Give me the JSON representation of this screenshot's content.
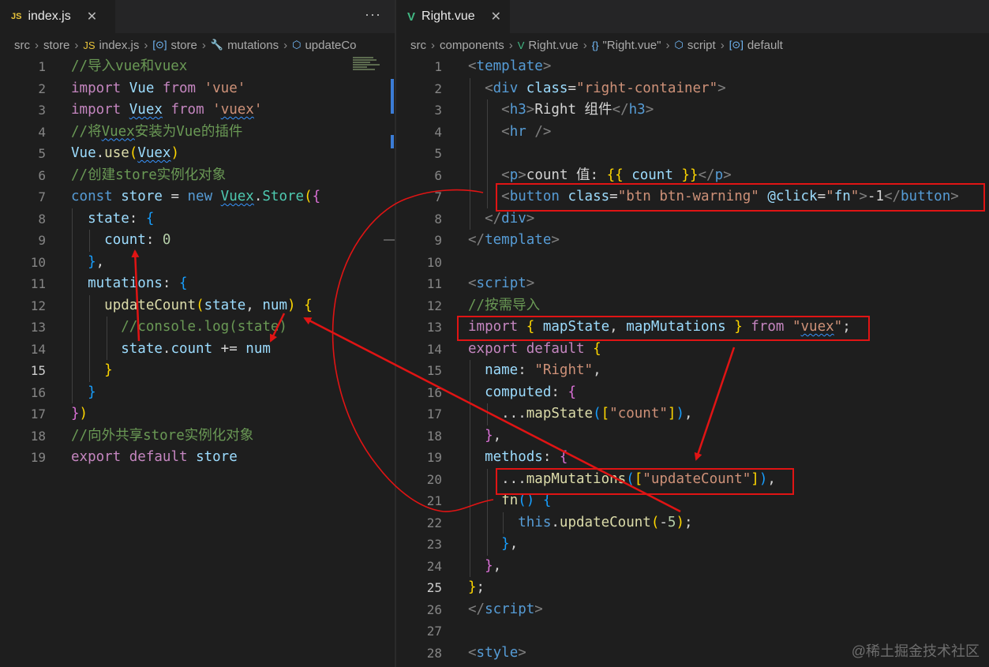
{
  "left_editor": {
    "tab": {
      "icon": "JS",
      "label": "index.js",
      "close": "✕"
    },
    "more_actions": "···",
    "breadcrumb": [
      {
        "text": "src",
        "icon": ""
      },
      {
        "text": "store",
        "icon": ""
      },
      {
        "text": "index.js",
        "icon": "JS"
      },
      {
        "text": "store",
        "icon": "[⊙]"
      },
      {
        "text": "mutations",
        "icon": "🔧"
      },
      {
        "text": "updateCo",
        "icon": "⬡"
      }
    ],
    "active_line": 15,
    "lines": [
      [
        [
          "cm",
          "//导入vue和vuex"
        ]
      ],
      [
        [
          "kw",
          "import "
        ],
        [
          "var",
          "Vue "
        ],
        [
          "kw",
          "from "
        ],
        [
          "str",
          "'vue'"
        ]
      ],
      [
        [
          "kw",
          "import "
        ],
        [
          "var wv",
          "Vuex"
        ],
        [
          "",
          " "
        ],
        [
          "kw",
          "from "
        ],
        [
          "str",
          "'"
        ],
        [
          "str wv",
          "vuex"
        ],
        [
          "str",
          "'"
        ]
      ],
      [
        [
          "cm",
          "//将"
        ],
        [
          "cm wv",
          "Vuex"
        ],
        [
          "cm",
          "安装为Vue的插件"
        ]
      ],
      [
        [
          "var",
          "Vue"
        ],
        [
          "",
          "."
        ],
        [
          "fn",
          "use"
        ],
        [
          "p1",
          "("
        ],
        [
          "var wv",
          "Vuex"
        ],
        [
          "p1",
          ")"
        ]
      ],
      [
        [
          "cm",
          "//创建store实例化对象"
        ]
      ],
      [
        [
          "kwb",
          "const "
        ],
        [
          "var",
          "store "
        ],
        [
          "",
          "= "
        ],
        [
          "kwb",
          "new "
        ],
        [
          "cls wv",
          "Vuex"
        ],
        [
          "",
          "."
        ],
        [
          "cls",
          "Store"
        ],
        [
          "p1",
          "("
        ],
        [
          "p2",
          "{"
        ]
      ],
      [
        [
          "",
          "  "
        ],
        [
          "var",
          "state"
        ],
        [
          "",
          ": "
        ],
        [
          "p3",
          "{"
        ]
      ],
      [
        [
          "",
          "    "
        ],
        [
          "var",
          "count"
        ],
        [
          "",
          ": "
        ],
        [
          "num",
          "0"
        ]
      ],
      [
        [
          "",
          "  "
        ],
        [
          "p3",
          "}"
        ],
        [
          "",
          ","
        ]
      ],
      [
        [
          "",
          "  "
        ],
        [
          "var",
          "mutations"
        ],
        [
          "",
          ": "
        ],
        [
          "p3",
          "{"
        ]
      ],
      [
        [
          "",
          "    "
        ],
        [
          "fn",
          "updateCount"
        ],
        [
          "p1",
          "("
        ],
        [
          "var",
          "state"
        ],
        [
          "",
          ", "
        ],
        [
          "var",
          "num"
        ],
        [
          "p1",
          ")"
        ],
        [
          "",
          " "
        ],
        [
          "p1",
          "{"
        ]
      ],
      [
        [
          "",
          "      "
        ],
        [
          "cm",
          "//console.log(state)"
        ]
      ],
      [
        [
          "",
          "      "
        ],
        [
          "var",
          "state"
        ],
        [
          "",
          "."
        ],
        [
          "var",
          "count"
        ],
        [
          "",
          " += "
        ],
        [
          "var",
          "num"
        ]
      ],
      [
        [
          "",
          "    "
        ],
        [
          "p1",
          "}"
        ]
      ],
      [
        [
          "",
          "  "
        ],
        [
          "p3",
          "}"
        ]
      ],
      [
        [
          "p2",
          "}"
        ],
        [
          "p1",
          ")"
        ]
      ],
      [
        [
          "cm",
          "//向外共享store实例化对象"
        ]
      ],
      [
        [
          "kw",
          "export "
        ],
        [
          "kw",
          "default "
        ],
        [
          "var",
          "store"
        ]
      ]
    ]
  },
  "right_editor": {
    "tab": {
      "icon": "V",
      "label": "Right.vue",
      "close": "✕"
    },
    "breadcrumb": [
      {
        "text": "src",
        "icon": ""
      },
      {
        "text": "components",
        "icon": ""
      },
      {
        "text": "Right.vue",
        "icon": "V"
      },
      {
        "text": "\"Right.vue\"",
        "icon": "{}"
      },
      {
        "text": "script",
        "icon": "⬡"
      },
      {
        "text": "default",
        "icon": "[⊙]"
      }
    ],
    "active_line": 25,
    "lines": [
      [
        [
          "ang",
          "<"
        ],
        [
          "tag",
          "template"
        ],
        [
          "ang",
          ">"
        ]
      ],
      [
        [
          "",
          "  "
        ],
        [
          "ang",
          "<"
        ],
        [
          "tag",
          "div "
        ],
        [
          "attr",
          "class"
        ],
        [
          "",
          "="
        ],
        [
          "str",
          "\"right-container\""
        ],
        [
          "ang",
          ">"
        ]
      ],
      [
        [
          "",
          "    "
        ],
        [
          "ang",
          "<"
        ],
        [
          "tag",
          "h3"
        ],
        [
          "ang",
          ">"
        ],
        [
          "",
          "Right 组件"
        ],
        [
          "ang",
          "</"
        ],
        [
          "tag",
          "h3"
        ],
        [
          "ang",
          ">"
        ]
      ],
      [
        [
          "",
          "    "
        ],
        [
          "ang",
          "<"
        ],
        [
          "tag",
          "hr "
        ],
        [
          "ang",
          "/>"
        ]
      ],
      [],
      [
        [
          "",
          "    "
        ],
        [
          "ang",
          "<"
        ],
        [
          "tag",
          "p"
        ],
        [
          "ang",
          ">"
        ],
        [
          "",
          "count 值: "
        ],
        [
          "p1",
          "{{ "
        ],
        [
          "var",
          "count"
        ],
        [
          "p1",
          " }}"
        ],
        [
          "ang",
          "</"
        ],
        [
          "tag",
          "p"
        ],
        [
          "ang",
          ">"
        ]
      ],
      [
        [
          "",
          "    "
        ],
        [
          "ang",
          "<"
        ],
        [
          "tag",
          "button "
        ],
        [
          "attr",
          "class"
        ],
        [
          "",
          "="
        ],
        [
          "str",
          "\"btn btn-warning\""
        ],
        [
          "",
          " "
        ],
        [
          "attr",
          "@click"
        ],
        [
          "",
          "="
        ],
        [
          "str",
          "\""
        ],
        [
          "var",
          "fn"
        ],
        [
          "str",
          "\""
        ],
        [
          "ang",
          ">"
        ],
        [
          "",
          "-1"
        ],
        [
          "ang",
          "</"
        ],
        [
          "tag",
          "button"
        ],
        [
          "ang",
          ">"
        ]
      ],
      [
        [
          "",
          "  "
        ],
        [
          "ang",
          "</"
        ],
        [
          "tag",
          "div"
        ],
        [
          "ang",
          ">"
        ]
      ],
      [
        [
          "ang",
          "</"
        ],
        [
          "tag",
          "template"
        ],
        [
          "ang",
          ">"
        ]
      ],
      [],
      [
        [
          "ang",
          "<"
        ],
        [
          "tag",
          "script"
        ],
        [
          "ang",
          ">"
        ]
      ],
      [
        [
          "cm",
          "//按需导入"
        ]
      ],
      [
        [
          "kw",
          "import "
        ],
        [
          "p1",
          "{ "
        ],
        [
          "var",
          "mapState"
        ],
        [
          "",
          ", "
        ],
        [
          "var",
          "mapMutations"
        ],
        [
          "p1",
          " }"
        ],
        [
          "",
          " "
        ],
        [
          "kw",
          "from "
        ],
        [
          "str",
          "\""
        ],
        [
          "str wv",
          "vuex"
        ],
        [
          "str",
          "\""
        ],
        [
          "",
          ";"
        ]
      ],
      [
        [
          "kw",
          "export "
        ],
        [
          "kw",
          "default "
        ],
        [
          "p1",
          "{"
        ]
      ],
      [
        [
          "",
          "  "
        ],
        [
          "var",
          "name"
        ],
        [
          "",
          ": "
        ],
        [
          "str",
          "\"Right\""
        ],
        [
          "",
          ","
        ]
      ],
      [
        [
          "",
          "  "
        ],
        [
          "var",
          "computed"
        ],
        [
          "",
          ": "
        ],
        [
          "p2",
          "{"
        ]
      ],
      [
        [
          "",
          "    ..."
        ],
        [
          "fn",
          "mapState"
        ],
        [
          "p3",
          "("
        ],
        [
          "p1",
          "["
        ],
        [
          "str",
          "\"count\""
        ],
        [
          "p1",
          "]"
        ],
        [
          "p3",
          ")"
        ],
        [
          "",
          ","
        ]
      ],
      [
        [
          "",
          "  "
        ],
        [
          "p2",
          "}"
        ],
        [
          "",
          ","
        ]
      ],
      [
        [
          "",
          "  "
        ],
        [
          "var",
          "methods"
        ],
        [
          "",
          ": "
        ],
        [
          "p2",
          "{"
        ]
      ],
      [
        [
          "",
          "    ..."
        ],
        [
          "fn",
          "mapMutations"
        ],
        [
          "p3",
          "("
        ],
        [
          "p1",
          "["
        ],
        [
          "str",
          "\"updateCount\""
        ],
        [
          "p1",
          "]"
        ],
        [
          "p3",
          ")"
        ],
        [
          "",
          ","
        ]
      ],
      [
        [
          "",
          "    "
        ],
        [
          "fn",
          "fn"
        ],
        [
          "p3",
          "()"
        ],
        [
          "",
          " "
        ],
        [
          "p3",
          "{"
        ]
      ],
      [
        [
          "",
          "      "
        ],
        [
          "kwb",
          "this"
        ],
        [
          "",
          "."
        ],
        [
          "fn",
          "updateCount"
        ],
        [
          "p1",
          "("
        ],
        [
          "",
          "-"
        ],
        [
          "num",
          "5"
        ],
        [
          "p1",
          ")"
        ],
        [
          "",
          ";"
        ]
      ],
      [
        [
          "",
          "    "
        ],
        [
          "p3",
          "}"
        ],
        [
          "",
          ","
        ]
      ],
      [
        [
          "",
          "  "
        ],
        [
          "p2",
          "}"
        ],
        [
          "",
          ","
        ]
      ],
      [
        [
          "p1",
          "}"
        ],
        [
          "",
          ";"
        ]
      ],
      [
        [
          "ang",
          "</"
        ],
        [
          "tag",
          "script"
        ],
        [
          "ang",
          ">"
        ]
      ],
      [],
      [
        [
          "ang",
          "<"
        ],
        [
          "tag",
          "style"
        ],
        [
          "ang",
          ">"
        ]
      ]
    ]
  },
  "watermark": "@稀土掘金技术社区",
  "colors": {
    "annotation": "#e01414",
    "editor_bg": "#1e1e1e",
    "tabbar_bg": "#252526",
    "vue_icon": "#41b883",
    "js_icon": "#e8c33a"
  }
}
